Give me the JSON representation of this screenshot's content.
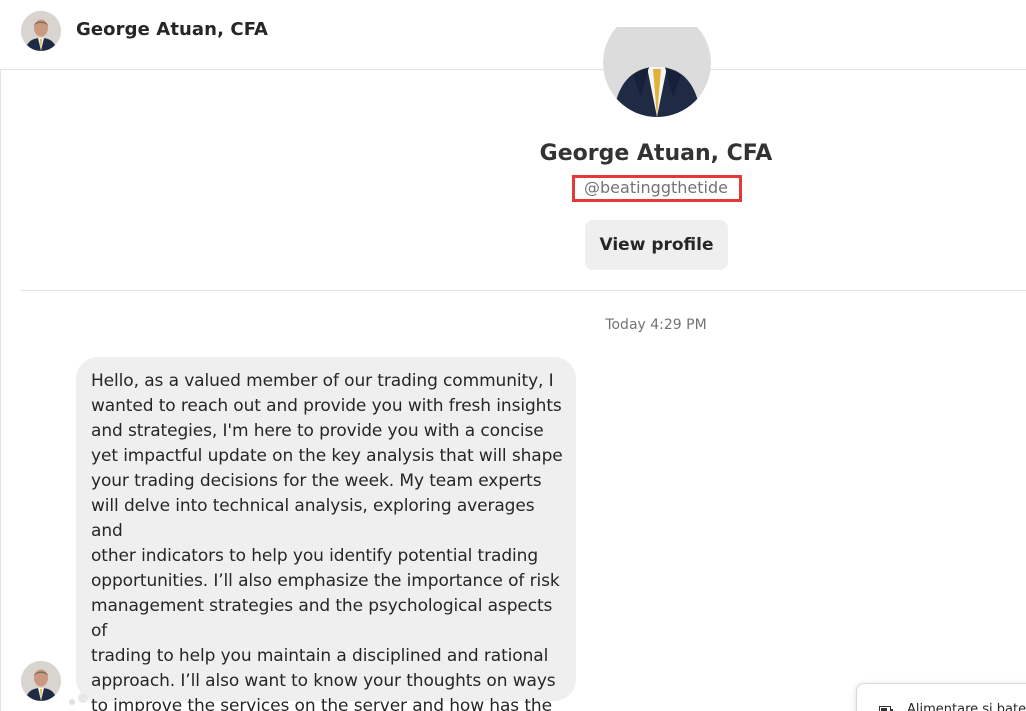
{
  "header": {
    "name": "George Atuan, CFA",
    "avatar_icon": "profile-photo-avatar"
  },
  "profile": {
    "name": "George Atuan, CFA",
    "handle": "@beatinggthetide",
    "view_profile_label": "View profile",
    "highlight_color": "#e53935"
  },
  "conversation": {
    "timestamp": "Today 4:29 PM",
    "messages": [
      {
        "sender": "George Atuan, CFA",
        "text": "Hello, as a valued member of our trading community, I\nwanted to reach out and provide you with fresh insights\nand strategies, I'm here to provide you with a concise\nyet impactful update on the key analysis that will shape\nyour trading decisions for the week. My team experts\nwill delve into technical analysis, exploring averages and\nother indicators to help you identify potential trading\nopportunities. I’ll also emphasize the importance of risk\nmanagement strategies and the psychological aspects of\ntrading to help you maintain a disciplined and rational\napproach. I’ll also want to know your thoughts on ways\nto improve the services on the server and how has the\nmarket been treating you lately?"
      }
    ]
  },
  "popup": {
    "text": "Alimentare și bate",
    "icon": "battery-icon"
  }
}
